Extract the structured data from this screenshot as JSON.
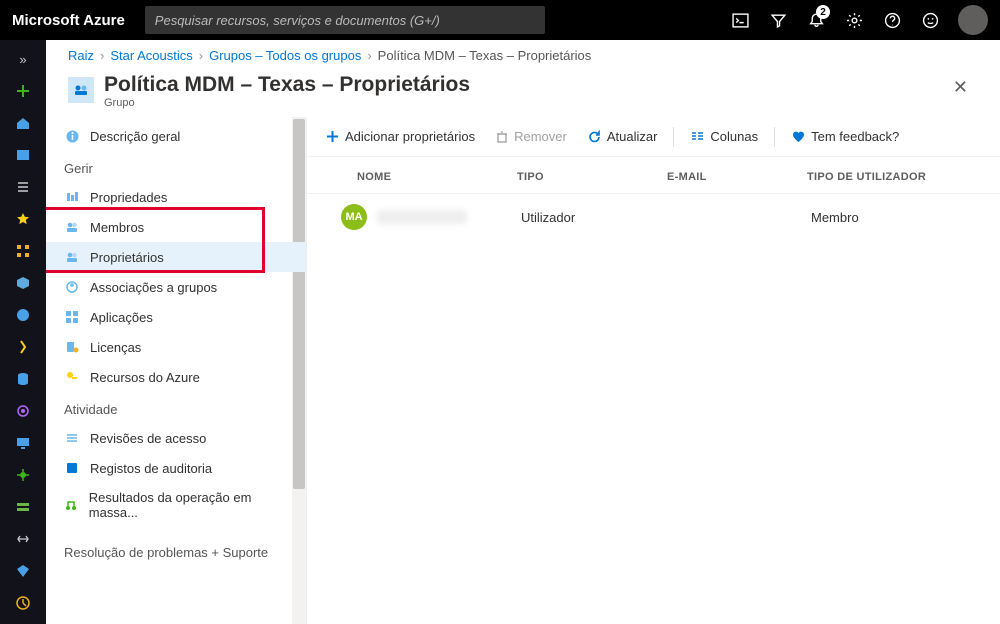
{
  "brand": "Microsoft Azure",
  "search": {
    "placeholder": "Pesquisar recursos, serviços e documentos (G+/)"
  },
  "notifications": {
    "count": "2"
  },
  "breadcrumbs": {
    "items": [
      "Raiz",
      "Star Acoustics",
      "Grupos – Todos os grupos"
    ],
    "current": "Política MDM – Texas – Proprietários"
  },
  "page": {
    "title": "Política MDM – Texas – Proprietários",
    "subtitle": "Grupo"
  },
  "nav": {
    "overview": "Descrição geral",
    "section_manage": "Gerir",
    "properties": "Propriedades",
    "members": "Membros",
    "owners": "Proprietários",
    "group_memberships": "Associações a grupos",
    "applications": "Aplicações",
    "licenses": "Licenças",
    "azure_resources": "Recursos do Azure",
    "section_activity": "Atividade",
    "access_reviews": "Revisões de acesso",
    "audit_logs": "Registos de auditoria",
    "bulk_op": "Resultados da operação em massa...",
    "section_support": "Resolução de problemas + Suporte"
  },
  "cmdbar": {
    "add_owners": "Adicionar proprietários",
    "remove": "Remover",
    "refresh": "Atualizar",
    "columns": "Colunas",
    "feedback": "Tem feedback?"
  },
  "table": {
    "headers": {
      "name": "NOME",
      "type": "TIPO",
      "email": "E-MAIL",
      "user_type": "TIPO DE UTILIZADOR"
    },
    "rows": [
      {
        "initials": "MA",
        "name": "",
        "type": "Utilizador",
        "email": "",
        "user_type": "Membro"
      }
    ]
  }
}
